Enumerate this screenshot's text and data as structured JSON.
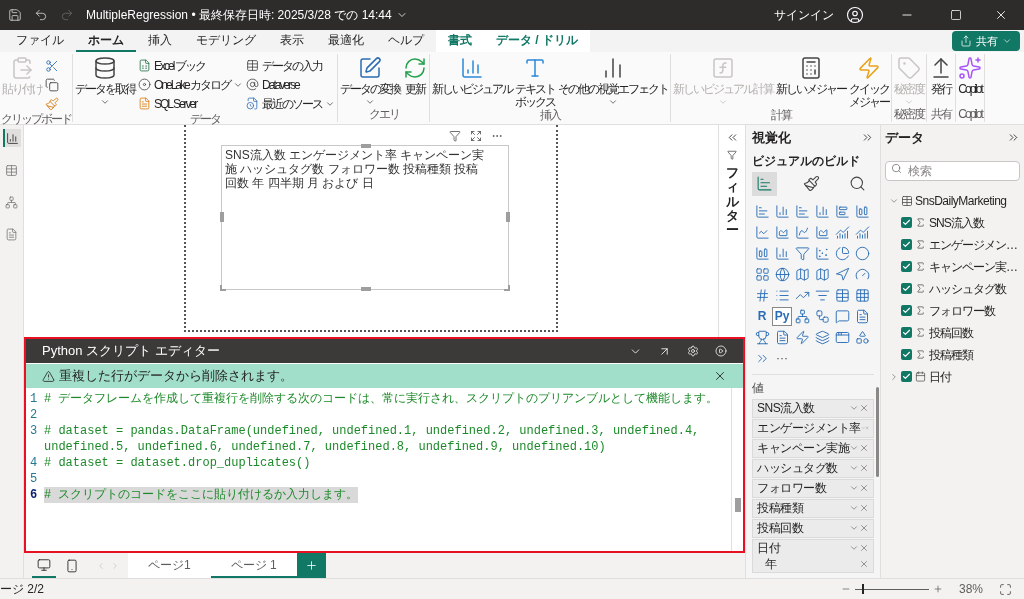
{
  "title_bar": {
    "title": "MultipleRegression • 最終保存日時: 2025/3/28 での 14:44",
    "sign_in": "サインイン"
  },
  "menu_tabs": [
    {
      "label": "ファイル",
      "selected": false,
      "kind": "normal"
    },
    {
      "label": "ホーム",
      "selected": true,
      "kind": "normal"
    },
    {
      "label": "挿入",
      "selected": false,
      "kind": "normal"
    },
    {
      "label": "モデリング",
      "selected": false,
      "kind": "normal"
    },
    {
      "label": "表示",
      "selected": false,
      "kind": "normal"
    },
    {
      "label": "最適化",
      "selected": false,
      "kind": "normal"
    },
    {
      "label": "ヘルプ",
      "selected": false,
      "kind": "normal"
    },
    {
      "label": "書式",
      "selected": false,
      "kind": "contextual"
    },
    {
      "label": "データ / ドリル",
      "selected": false,
      "kind": "contextual"
    }
  ],
  "share_button": "共有",
  "ribbon": {
    "groups": [
      {
        "label": "クリップボード",
        "items": [
          {
            "kind": "large",
            "label": "貼り付け",
            "disabled": true,
            "dropdown": false
          },
          {
            "kind": "icon",
            "disabled": false
          },
          {
            "kind": "icon",
            "disabled": false
          },
          {
            "kind": "icon",
            "disabled": false
          }
        ]
      },
      {
        "label": "データ",
        "items": [
          {
            "kind": "large",
            "label": "データを取得",
            "disabled": false,
            "dropdown": true
          },
          {
            "kind": "small",
            "label": "Excel ブック",
            "disabled": false,
            "dropdown": false
          },
          {
            "kind": "small",
            "label": "OneLake カタログ",
            "disabled": false,
            "dropdown": true
          },
          {
            "kind": "small",
            "label": "SQL Server",
            "disabled": false,
            "dropdown": false
          },
          {
            "kind": "small",
            "label": "データの入力",
            "disabled": false,
            "dropdown": false
          },
          {
            "kind": "small",
            "label": "Dataverse",
            "disabled": false,
            "dropdown": false
          },
          {
            "kind": "small",
            "label": "最近のソース",
            "disabled": false,
            "dropdown": true
          }
        ]
      },
      {
        "label": "クエリ",
        "items": [
          {
            "kind": "large",
            "label": "データの変換",
            "disabled": false,
            "dropdown": true
          },
          {
            "kind": "large",
            "label": "更新",
            "disabled": false,
            "dropdown": false
          }
        ]
      },
      {
        "label": "挿入",
        "items": [
          {
            "kind": "large",
            "label": "新しいビジュアル",
            "disabled": false,
            "dropdown": false
          },
          {
            "kind": "large",
            "label_lines": [
              "テキスト",
              "ボックス"
            ],
            "disabled": false,
            "dropdown": false
          },
          {
            "kind": "large",
            "label": "その他の視覚エフェクト",
            "disabled": false,
            "dropdown": true
          }
        ]
      },
      {
        "label": "計算",
        "items": [
          {
            "kind": "large",
            "label": "新しいビジュアル計算",
            "disabled": true,
            "dropdown": true
          },
          {
            "kind": "large",
            "label": "新しいメジャー",
            "disabled": false,
            "dropdown": false
          },
          {
            "kind": "large",
            "label_lines": [
              "クイック",
              "メジャー"
            ],
            "disabled": false,
            "dropdown": false
          }
        ]
      },
      {
        "label": "秘密度",
        "items": [
          {
            "kind": "large",
            "label": "秘密度",
            "disabled": true,
            "dropdown": true
          }
        ]
      },
      {
        "label": "共有",
        "items": [
          {
            "kind": "large",
            "label": "発行",
            "disabled": false,
            "dropdown": false
          }
        ]
      },
      {
        "label": "Copilot",
        "items": [
          {
            "kind": "large",
            "label": "Copilot",
            "disabled": false,
            "dropdown": false
          }
        ]
      }
    ]
  },
  "left_rail": {
    "views": [
      {
        "selected": true
      },
      {
        "selected": false
      },
      {
        "selected": false
      },
      {
        "selected": false
      }
    ]
  },
  "visual": {
    "title": "SNS流入数 エンゲージメント率 キャンペーン実施 ハッシュタグ数 フォロワー数 投稿種類 投稿回数 年 四半期 月 および 日"
  },
  "filters": {
    "label": "フィルター"
  },
  "script_editor": {
    "title": "Python スクリプト エディター",
    "warning": "重複した行がデータから削除されます。",
    "lines": [
      {
        "number": "1",
        "text": "# データフレームを作成して重複行を削除する次のコードは、常に実行され、スクリプトのプリアンブルとして機能します。",
        "highlighted": false
      },
      {
        "number": "2",
        "highlighted": false
      },
      {
        "number": "3",
        "text": "# dataset = pandas.DataFrame(undefined, undefined.1, undefined.2, undefined.3, undefined.4, undefined.5, undefined.6, undefined.7, undefined.8, undefined.9, undefined.10)",
        "highlighted": false
      },
      {
        "number": "4",
        "text": "# dataset = dataset.drop_duplicates()",
        "highlighted": false
      },
      {
        "number": "5",
        "highlighted": false
      },
      {
        "number": "6",
        "text": "# スクリプトのコードをここに貼り付けるか入力します。",
        "highlighted": true
      }
    ]
  },
  "page_tabs": [
    {
      "label": "ページ1",
      "selected": false
    },
    {
      "label": "ページ 1",
      "selected": true
    }
  ],
  "visualizations": {
    "title": "視覚化",
    "build_label": "ビジュアルのビルド",
    "build_tabs": [
      {
        "selected": true
      },
      {
        "selected": false
      },
      {
        "selected": false
      }
    ],
    "script_visuals": [
      {
        "label": "R",
        "selected": false
      },
      {
        "label": "Py",
        "selected": true
      }
    ],
    "more": "···",
    "well_label": "値",
    "fields": [
      {
        "label": "SNS流入数"
      },
      {
        "label": "エンゲージメント率"
      },
      {
        "label": "キャンペーン実施"
      },
      {
        "label": "ハッシュタグ数"
      },
      {
        "label": "フォロワー数"
      },
      {
        "label": "投稿種類"
      },
      {
        "label": "投稿回数"
      },
      {
        "label": "日付",
        "children": [
          {
            "label": "年"
          }
        ]
      }
    ]
  },
  "data_pane": {
    "title": "データ",
    "search": {
      "placeholder": "検索"
    },
    "table": {
      "name": "SnsDailyMarketing",
      "expanded": true,
      "children": [
        {
          "label": "SNS流入数",
          "checked": true,
          "kind": "measure"
        },
        {
          "label": "エンゲージメン…",
          "checked": true,
          "kind": "measure"
        },
        {
          "label": "キャンペーン実…",
          "checked": true,
          "kind": "measure"
        },
        {
          "label": "ハッシュタグ数",
          "checked": true,
          "kind": "measure"
        },
        {
          "label": "フォロワー数",
          "checked": true,
          "kind": "measure"
        },
        {
          "label": "投稿回数",
          "checked": true,
          "kind": "measure"
        },
        {
          "label": "投稿種類",
          "checked": true,
          "kind": "measure"
        },
        {
          "label": "日付",
          "checked": true,
          "kind": "date",
          "expanded": false
        }
      ]
    }
  },
  "status_bar": {
    "page": "ージ 2/2",
    "zoom": {
      "level": 0.1,
      "reading": "38%"
    }
  }
}
